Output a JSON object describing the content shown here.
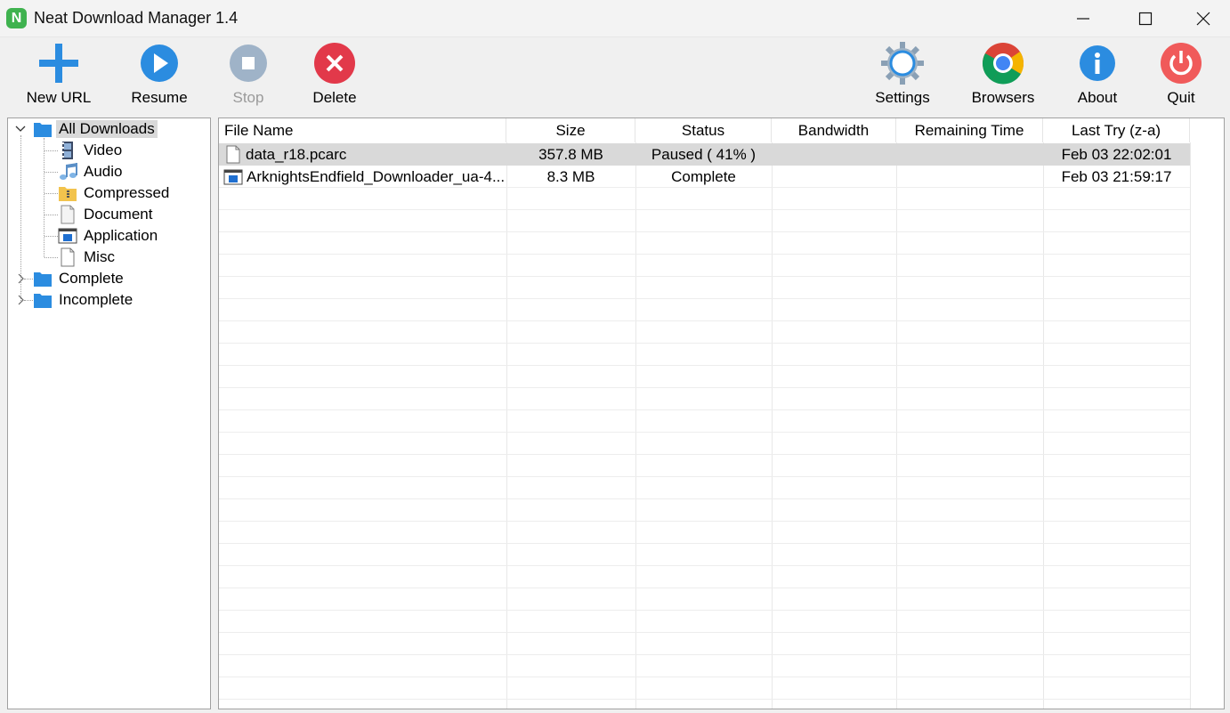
{
  "window": {
    "title": "Neat Download Manager 1.4",
    "app_icon_letter": "N"
  },
  "toolbar": {
    "new_url": "New URL",
    "resume": "Resume",
    "stop": "Stop",
    "delete": "Delete",
    "settings": "Settings",
    "browsers": "Browsers",
    "about": "About",
    "quit": "Quit"
  },
  "tree": {
    "all_downloads": "All Downloads",
    "children": [
      "Video",
      "Audio",
      "Compressed",
      "Document",
      "Application",
      "Misc"
    ],
    "complete": "Complete",
    "incomplete": "Incomplete"
  },
  "list": {
    "columns": [
      "File Name",
      "Size",
      "Status",
      "Bandwidth",
      "Remaining Time",
      "Last Try (z-a)"
    ],
    "rows": [
      {
        "name": "data_r18.pcarc",
        "size": "357.8 MB",
        "status": "Paused ( 41% )",
        "bandwidth": "",
        "remaining": "",
        "last_try": "Feb 03 22:02:01",
        "icon": "document-icon"
      },
      {
        "name": "ArknightsEndfield_Downloader_ua-4...",
        "size": "8.3 MB",
        "status": "Complete",
        "bandwidth": "",
        "remaining": "",
        "last_try": "Feb 03 21:59:17",
        "icon": "application-icon"
      }
    ]
  },
  "colors": {
    "accent_blue": "#2b8ce0",
    "delete_red": "#e2394a",
    "quit_red": "#f05a5a",
    "selection": "#d9d9d9"
  }
}
